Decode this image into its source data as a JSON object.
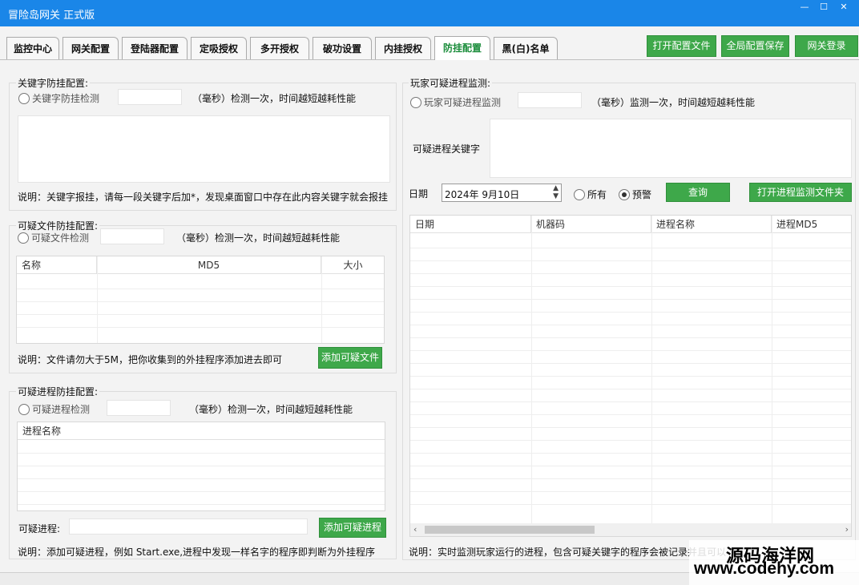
{
  "window": {
    "title": "冒险岛网关 正式版",
    "min": "—",
    "max": "☐",
    "close": "✕"
  },
  "tabs": [
    "监控中心",
    "网关配置",
    "登陆器配置",
    "定吸授权",
    "多开授权",
    "破功设置",
    "内挂授权",
    "防挂配置",
    "黑(白)名单"
  ],
  "active_tab": "防挂配置",
  "top_buttons": {
    "open_config": "打开配置文件",
    "global_save": "全局配置保存",
    "gateway_login": "网关登录"
  },
  "keyword": {
    "group_title": "关键字防挂配置:",
    "radio_label": "关键字防挂检测",
    "unit_text": "（毫秒）检测一次，时间越短越耗性能",
    "note": "说明：关键字报挂，请每一段关键字后加*，发现桌面窗口中存在此内容关键字就会报挂"
  },
  "file": {
    "group_title": "可疑文件防挂配置:",
    "radio_label": "可疑文件检测",
    "unit_text": "（毫秒）检测一次，时间越短越耗性能",
    "columns": [
      "名称",
      "MD5",
      "大小"
    ],
    "note": "说明：文件请勿大于5M，把你收集到的外挂程序添加进去即可",
    "add_button": "添加可疑文件"
  },
  "process": {
    "group_title": "可疑进程防挂配置:",
    "radio_label": "可疑进程检测",
    "unit_text": "（毫秒）检测一次，时间越短越耗性能",
    "column": "进程名称",
    "input_label": "可疑进程:",
    "add_button": "添加可疑进程",
    "note": "说明：添加可疑进程，例如 Start.exe,进程中发现一样名字的程序即判断为外挂程序"
  },
  "monitor": {
    "group_title": "玩家可疑进程监测:",
    "radio_label": "玩家可疑进程监测",
    "unit_text": "（毫秒）监测一次，时间越短越耗性能",
    "keyword_label": "可疑进程关键字",
    "date_label": "日期",
    "date_value": "2024年  9月10日",
    "radio_all": "所有",
    "radio_alert": "预警",
    "query_button": "查询",
    "open_folder_button": "打开进程监测文件夹",
    "columns": [
      "日期",
      "机器码",
      "进程名称",
      "进程MD5"
    ],
    "note": "说明：实时监测玩家运行的进程，包含可疑关键字的程序会被记录并且可以"
  },
  "watermark": {
    "line1": "源码海洋网",
    "line2": "www.codehy.com"
  }
}
